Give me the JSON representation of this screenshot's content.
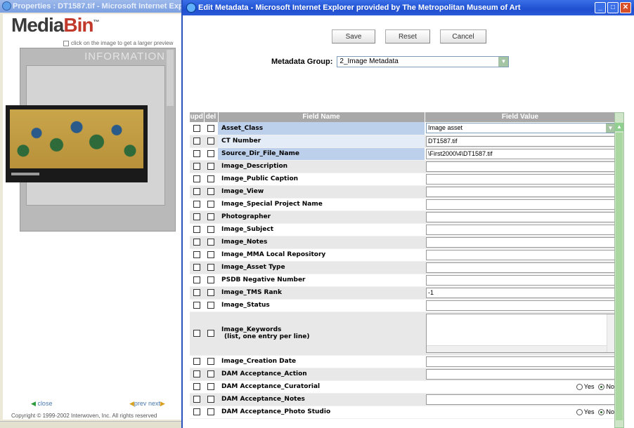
{
  "bg_window": {
    "title": "Properties : DT1587.tif - Microsoft Internet Exp",
    "brand_prefix": "Media",
    "brand_suffix": "Bin",
    "brand_mark": "™",
    "preview_hint": "click on the image to get a larger preview",
    "info_label": "INFORMATION",
    "close_label": "close",
    "prev_label": "prev",
    "next_label": "next",
    "copyright": "Copyright © 1999-2002 Interwoven, Inc. All rights reserved"
  },
  "dialog": {
    "title": "Edit Metadata - Microsoft Internet Explorer provided by The Metropolitan Museum of Art",
    "buttons": {
      "save": "Save",
      "reset": "Reset",
      "cancel": "Cancel"
    },
    "metadata_group": {
      "label": "Metadata Group:",
      "value": "2_Image Metadata"
    },
    "table": {
      "headers": {
        "upd": "upd",
        "del": "del",
        "field_name": "Field Name",
        "field_value": "Field Value"
      },
      "rows": [
        {
          "name": "Asset_Class",
          "value": "Image asset",
          "kind": "select"
        },
        {
          "name": "CT Number",
          "value": "DT1587.tif",
          "kind": "text"
        },
        {
          "name": "Source_Dir_File_Name",
          "value": "\\First2000\\4\\DT1587.tif",
          "kind": "text"
        },
        {
          "name": "Image_Description",
          "value": "",
          "kind": "text"
        },
        {
          "name": "Image_Public Caption",
          "value": "",
          "kind": "text"
        },
        {
          "name": "Image_View",
          "value": "",
          "kind": "text"
        },
        {
          "name": "Image_Special Project Name",
          "value": "",
          "kind": "text"
        },
        {
          "name": "Photographer",
          "value": "",
          "kind": "text"
        },
        {
          "name": "Image_Subject",
          "value": "",
          "kind": "text"
        },
        {
          "name": "Image_Notes",
          "value": "",
          "kind": "text"
        },
        {
          "name": "Image_MMA Local Repository",
          "value": "",
          "kind": "text"
        },
        {
          "name": "Image_Asset Type",
          "value": "",
          "kind": "text"
        },
        {
          "name": "PSDB Negative Number",
          "value": "",
          "kind": "text"
        },
        {
          "name": "Image_TMS Rank",
          "value": "-1",
          "kind": "text"
        },
        {
          "name": "Image_Status",
          "value": "",
          "kind": "text"
        },
        {
          "name": "Image_Keywords",
          "name2": "(list, one entry per line)",
          "value": "",
          "kind": "textarea"
        },
        {
          "name": "Image_Creation Date",
          "value": "",
          "kind": "text"
        },
        {
          "name": "DAM Acceptance_Action",
          "value": "",
          "kind": "text"
        },
        {
          "name": "DAM Acceptance_Curatorial",
          "kind": "radio",
          "yes": "Yes",
          "no": "No",
          "selected": "No"
        },
        {
          "name": "DAM Acceptance_Notes",
          "value": "",
          "kind": "text"
        },
        {
          "name": "DAM Acceptance_Photo Studio",
          "kind": "radio",
          "yes": "Yes",
          "no": "No",
          "selected": "No"
        }
      ]
    }
  }
}
